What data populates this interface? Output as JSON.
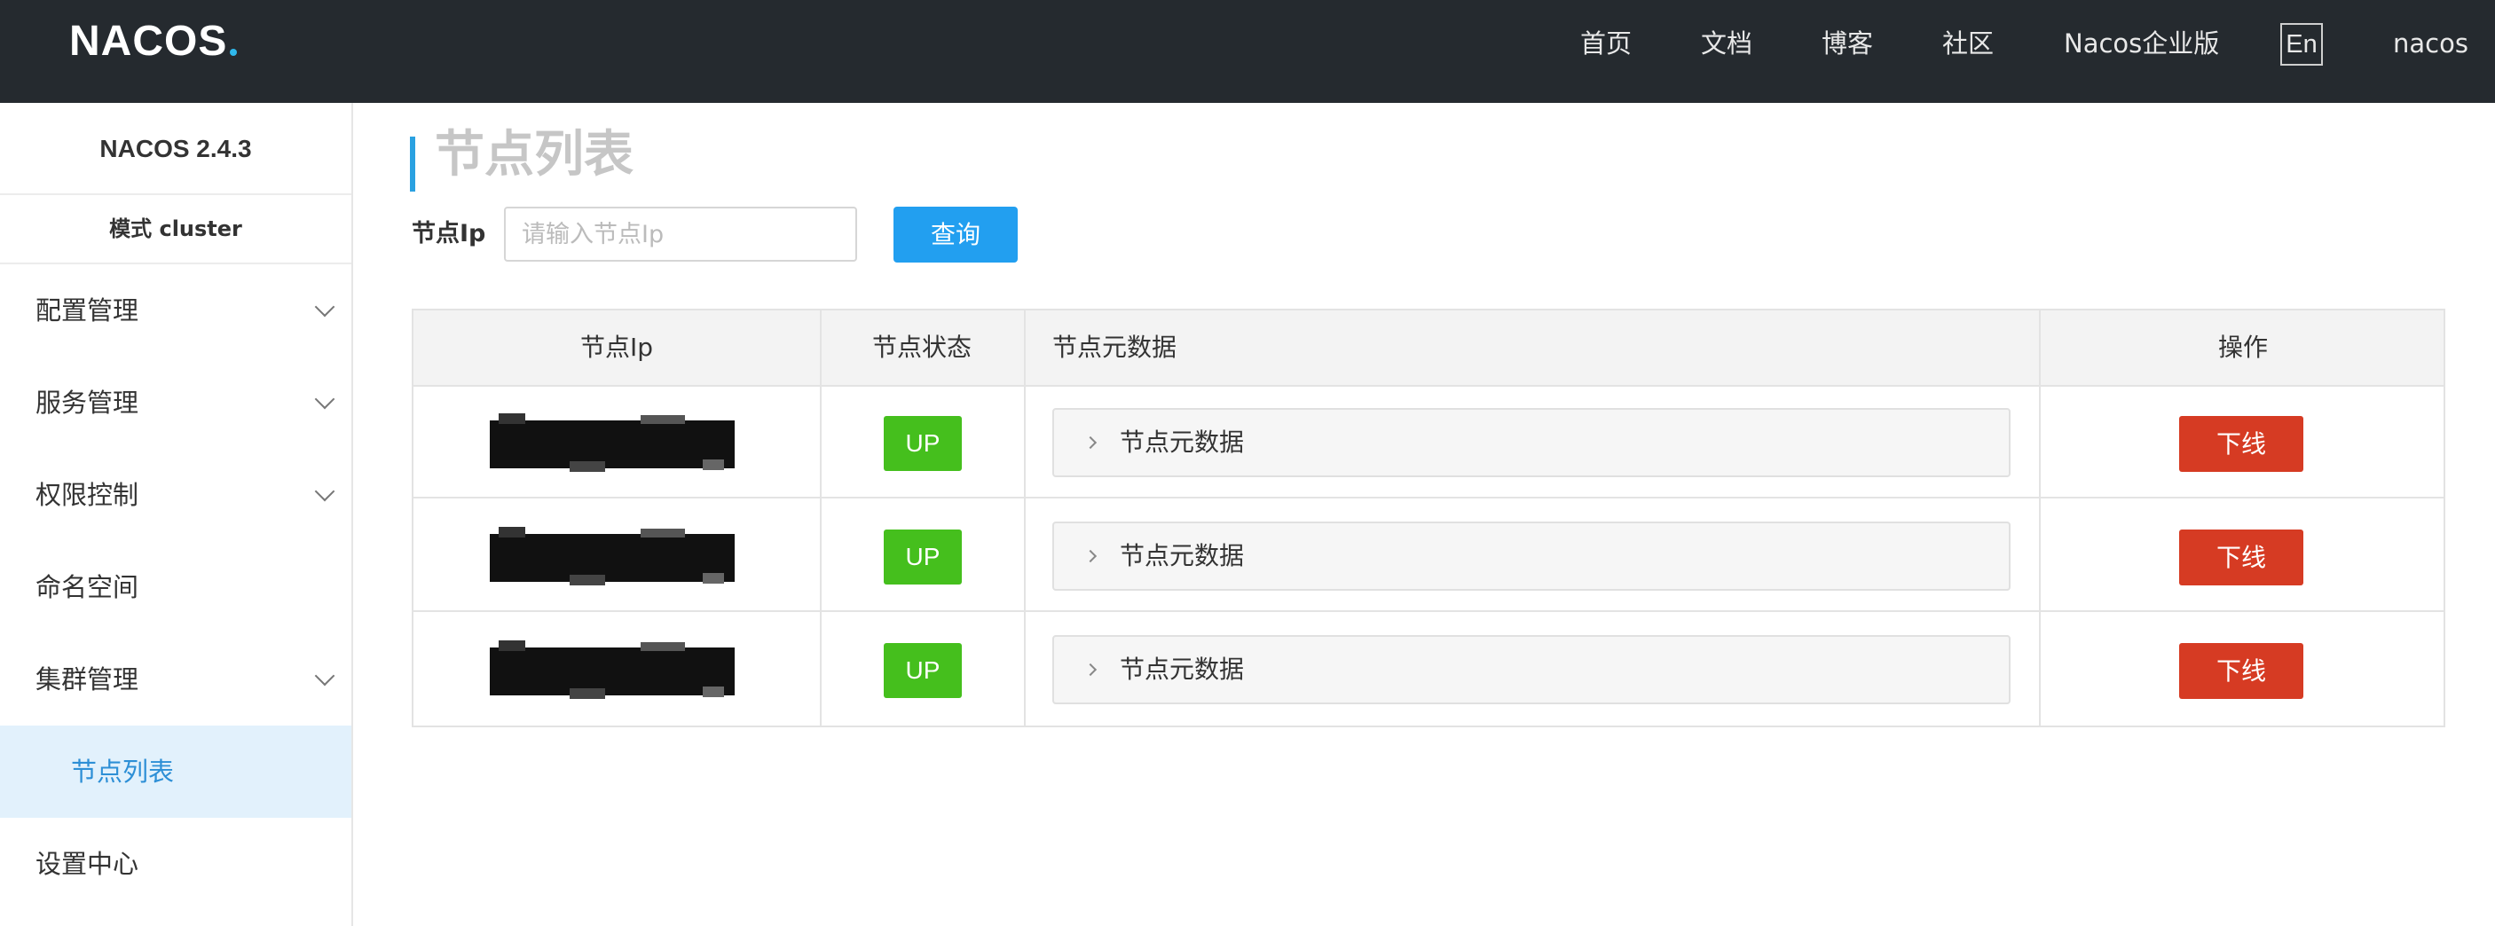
{
  "header": {
    "logo_text": "NACOS",
    "nav": [
      "首页",
      "文档",
      "博客",
      "社区",
      "Nacos企业版"
    ],
    "lang_button": "En",
    "user": "nacos"
  },
  "sidebar": {
    "version": "NACOS 2.4.3",
    "mode": "模式  cluster",
    "items": [
      {
        "label": "配置管理",
        "has_arrow": true
      },
      {
        "label": "服务管理",
        "has_arrow": true
      },
      {
        "label": "权限控制",
        "has_arrow": true
      },
      {
        "label": "命名空间",
        "has_arrow": false
      },
      {
        "label": "集群管理",
        "has_arrow": true
      },
      {
        "label": "节点列表",
        "has_arrow": false,
        "selected": true
      },
      {
        "label": "设置中心",
        "has_arrow": false
      }
    ]
  },
  "page": {
    "title": "节点列表"
  },
  "filter": {
    "label": "节点Ip",
    "placeholder": "请输入节点Ip",
    "value": "",
    "query_button": "查询"
  },
  "table": {
    "columns": [
      "节点Ip",
      "节点状态",
      "节点元数据",
      "操作"
    ],
    "rows": [
      {
        "ip": "",
        "status": "UP",
        "metadata_label": "节点元数据",
        "action": "下线"
      },
      {
        "ip": "",
        "status": "UP",
        "metadata_label": "节点元数据",
        "action": "下线"
      },
      {
        "ip": "",
        "status": "UP",
        "metadata_label": "节点元数据",
        "action": "下线"
      }
    ]
  },
  "colors": {
    "header_bg": "#252a2f",
    "accent_blue": "#229ff0",
    "status_up": "#45bf1d",
    "danger": "#d63b23",
    "sidebar_selected_bg": "#e2f1fc"
  }
}
